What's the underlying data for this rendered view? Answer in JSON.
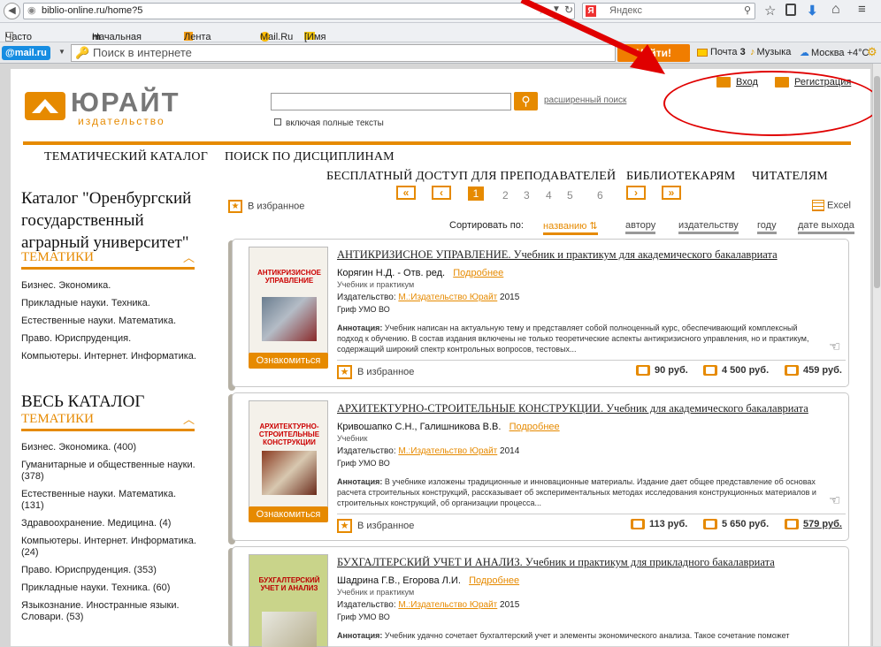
{
  "browser": {
    "url": "biblio-online.ru/home?5",
    "search_engine": "Яндекс",
    "bookmarks": [
      "Часто посещаемые",
      "Начальная страница",
      "Лента новостей",
      "Mail.Ru",
      "[Имя папки]"
    ]
  },
  "mailbar": {
    "logo": "@mail.ru",
    "search_placeholder": "Поиск в интернете",
    "find_button": "Найти!",
    "mail": "Почта",
    "mail_count": "3",
    "music": "Музыка",
    "weather": "Москва +4°C"
  },
  "site": {
    "logo_main": "ЮРАЙТ",
    "logo_sub": "издательство",
    "search_link": "расширенный поиск",
    "fulltext_label": "включая полные тексты",
    "login": "Вход",
    "register": "Регистрация",
    "nav1": [
      "ТЕМАТИЧЕСКИЙ КАТАЛОГ",
      "ПОИСК ПО ДИСЦИПЛИНАМ"
    ],
    "nav2": [
      "БЕСПЛАТНЫЙ ДОСТУП ДЛЯ ПРЕПОДАВАТЕЛЕЙ",
      "БИБЛИОТЕКАРЯМ",
      "ЧИТАТЕЛЯМ"
    ]
  },
  "catalog": {
    "title": "Каталог \"Оренбургский государственный аграрный университет\"",
    "themes_label": "ТЕМАТИКИ",
    "themes": [
      "Бизнес. Экономика.",
      "Прикладные науки. Техника.",
      "Естественные науки. Математика.",
      "Право. Юриспруденция.",
      "Компьютеры. Интернет. Информатика."
    ],
    "all_title": "ВЕСЬ КАТАЛОГ",
    "all_themes_label": "ТЕМАТИКИ",
    "all_themes": [
      "Бизнес. Экономика. (400)",
      "Гуманитарные и общественные науки. (378)",
      "Естественные науки. Математика. (131)",
      "Здравоохранение. Медицина. (4)",
      "Компьютеры. Интернет. Информатика. (24)",
      "Право. Юриспруденция. (353)",
      "Прикладные науки. Техника. (60)",
      "Языкознание. Иностранные языки. Словари. (53)"
    ]
  },
  "list": {
    "favorites": "В избранное",
    "excel": "Excel",
    "pages": [
      "1",
      "2",
      "3",
      "4",
      "5",
      "6"
    ],
    "sort_label": "Сортировать по:",
    "sort": [
      "названию",
      "автору",
      "издательству",
      "году",
      "дате выхода"
    ]
  },
  "books": [
    {
      "title": "АНТИКРИЗИСНОЕ УПРАВЛЕНИЕ. Учебник и практикум для академического бакалавриата",
      "cover_title": "АНТИКРИЗИСНОЕ УПРАВЛЕНИЕ",
      "authors": "Корягин Н.Д. - Отв. ред.",
      "more": "Подробнее",
      "type": "Учебник и практикум",
      "publisher_label": "Издательство:",
      "publisher": "М.:Издательство Юрайт",
      "year": "2015",
      "grif": "Гриф УМО ВО",
      "annotation_label": "Аннотация:",
      "annotation": "Учебник написан на актуальную тему и представляет собой полноценный курс, обеспечивающий комплексный подход к обучению. В состав издания включены не только теоретические аспекты антикризисного управления, но и практикум, содержащий широкий спектр контрольных вопросов, тестовых...",
      "read": "Ознакомиться",
      "fav": "В избранное",
      "prices": [
        "90 руб.",
        "4 500 руб.",
        "459 руб."
      ]
    },
    {
      "title": "АРХИТЕКТУРНО-СТРОИТЕЛЬНЫЕ КОНСТРУКЦИИ. Учебник для академического бакалавриата",
      "cover_title": "АРХИТЕКТУРНО-СТРОИТЕЛЬНЫЕ КОНСТРУКЦИИ",
      "authors": "Кривошапко С.Н., Галишникова В.В.",
      "more": "Подробнее",
      "type": "Учебник",
      "publisher_label": "Издательство:",
      "publisher": "М.:Издательство Юрайт",
      "year": "2014",
      "grif": "Гриф УМО ВО",
      "annotation_label": "Аннотация:",
      "annotation": "В учебнике изложены традиционные и инновационные материалы. Издание дает общее представление об основах расчета строительных конструкций, рассказывает об экспериментальных методах исследования конструкционных материалов и строительных конструкций, об организации процесса...",
      "read": "Ознакомиться",
      "fav": "В избранное",
      "prices": [
        "113 руб.",
        "5 650 руб.",
        "579 руб."
      ]
    },
    {
      "title": "БУХГАЛТЕРСКИЙ УЧЕТ И АНАЛИЗ. Учебник и практикум для прикладного бакалавриата",
      "cover_title": "БУХГАЛТЕРСКИЙ УЧЕТ И АНАЛИЗ",
      "authors": "Шадрина Г.В., Егорова Л.И.",
      "more": "Подробнее",
      "type": "Учебник и практикум",
      "publisher_label": "Издательство:",
      "publisher": "М.:Издательство Юрайт",
      "year": "2015",
      "grif": "Гриф УМО ВО",
      "annotation_label": "Аннотация:",
      "annotation": "Учебник удачно сочетает бухгалтерский учет и элементы экономического анализа. Такое сочетание поможет"
    }
  ],
  "colors": {
    "accent": "#e68a00",
    "annotation_red": "#e00000"
  }
}
